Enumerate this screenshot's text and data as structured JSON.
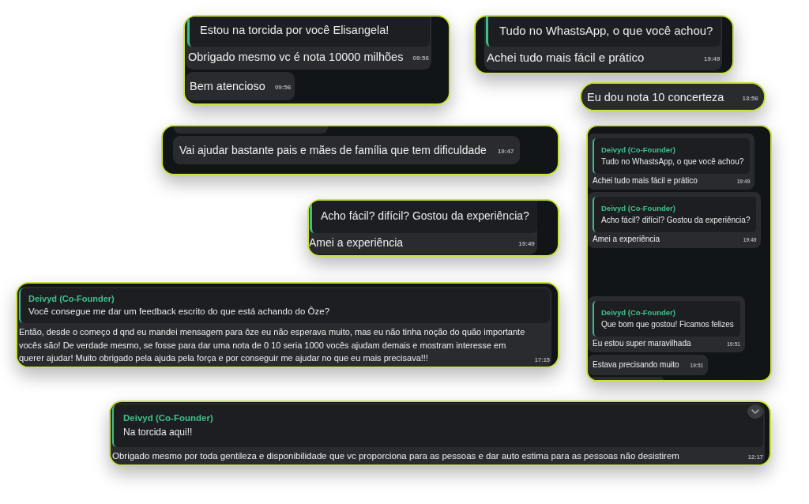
{
  "screenshots": [
    {
      "messages": [
        {
          "kind": "message",
          "quote": {
            "text": "Estou na torcida por você Elisangela!"
          },
          "text": "Obrigado mesmo vc é nota 10000 milhões",
          "time": "09:56"
        },
        {
          "kind": "message",
          "text": "Bem atencioso",
          "time": "09:56"
        }
      ]
    },
    {
      "messages": [
        {
          "kind": "message",
          "quote": {
            "text": "Tudo no WhastsApp, o que você achou?"
          },
          "text": "Achei tudo mais fácil e prático",
          "time": "19:49"
        }
      ]
    },
    {
      "messages": [
        {
          "kind": "message",
          "text": "Eu dou nota 10 concerteza",
          "time": "13:56"
        }
      ]
    },
    {
      "messages": [
        {
          "kind": "fragment"
        },
        {
          "kind": "message",
          "text": "Vai ajudar bastante pais e mães de família que tem dificuldade",
          "time": "19:47"
        }
      ]
    },
    {
      "messages": [
        {
          "kind": "message",
          "quote": {
            "text": "Acho fácil? difícil? Gostou da experiência?"
          },
          "text": "Amei a experiência",
          "time": "19:49"
        }
      ]
    },
    {
      "messages": [
        {
          "kind": "message",
          "quote": {
            "author": "Deivyd (Co-Founder)",
            "text": "Tudo no WhastsApp, o que você achou?"
          },
          "text": "Achei tudo mais fácil e prático",
          "time": "19:49"
        },
        {
          "kind": "message",
          "quote": {
            "author": "Deivyd (Co-Founder)",
            "text": "Acho fácil? difícil? Gostou da experiência?"
          },
          "text": "Amei a experiência",
          "time": "19:49"
        },
        {
          "kind": "message",
          "quote": {
            "author": "Deivyd (Co-Founder)",
            "text": "Que bom que gostou! Ficamos felizes"
          },
          "text": "Eu estou super maravilhada",
          "time": "19:51"
        },
        {
          "kind": "message",
          "text": "Estava precisando muito",
          "time": "19:51"
        },
        {
          "kind": "fragment"
        }
      ]
    },
    {
      "messages": [
        {
          "kind": "message",
          "quote": {
            "author": "Deivyd (Co-Founder)",
            "text": "Você consegue me dar um feedback escrito do que está achando do Ôze?"
          },
          "text": "Então, desde o começo d qnd eu mandei mensagem para ôze eu não esperava muito, mas eu não tinha noção do quão importante vocês são! De verdade mesmo, se fosse para dar uma nota de 0 10 seria 1000 vocês ajudam demais e mostram interesse em querer ajudar! Muito obrigado pela ajuda pela força e por conseguir me ajudar no que eu mais precisava!!!",
          "time": "17:15"
        }
      ]
    },
    {
      "messages": [
        {
          "kind": "message",
          "quote": {
            "author": "Deivyd (Co-Founder)",
            "text": "Na torcida aqui!!"
          },
          "text": "Obrigado mesmo por toda gentileza e disponibilidade que vc proporciona para as pessoas e dar auto estima para as pessoas não desistirem",
          "time": "12:17"
        }
      ]
    }
  ]
}
